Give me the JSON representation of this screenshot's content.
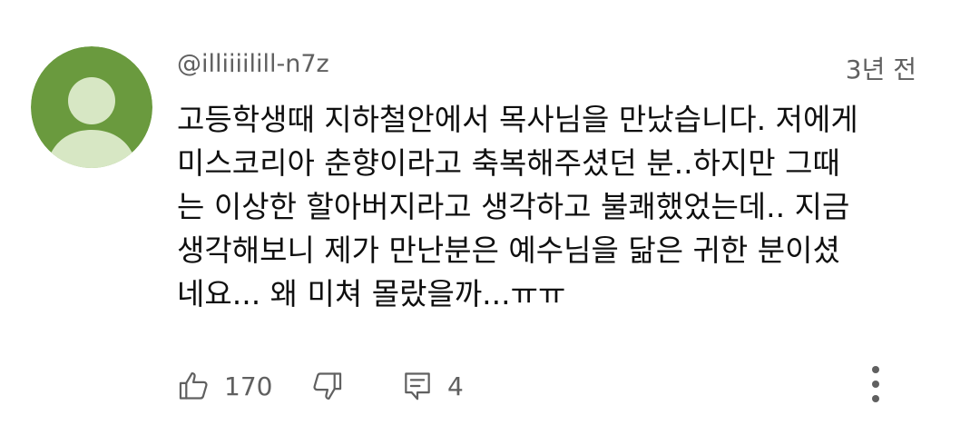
{
  "comment": {
    "username": "@illiiiilill-n7z",
    "timestamp": "3년 전",
    "text_lines": [
      "고등학생때 지하철안에서 목사님을 만났습니다. 저에게",
      "미스코리아 춘향이라고 축복해주셨던 분..하지만 그때",
      "는 이상한 할아버지라고 생각하고 불쾌했었는데.. 지금",
      "생각해보니 제가 만난분은 예수님을 닮은 귀한 분이셨",
      "네요... 왜 미쳐 몰랐을까...ㅠㅠ"
    ]
  },
  "actions": {
    "like_icon": "thumbs-up-icon",
    "like_count": "170",
    "dislike_icon": "thumbs-down-icon",
    "reply_icon": "reply-comment-icon",
    "reply_count": "4",
    "more_icon": "more-vertical-icon"
  },
  "colors": {
    "avatar_background": "#6a9a3e",
    "avatar_figure": "#d7e7c4",
    "secondary_text": "#606060",
    "primary_text": "#0f0f0f"
  }
}
